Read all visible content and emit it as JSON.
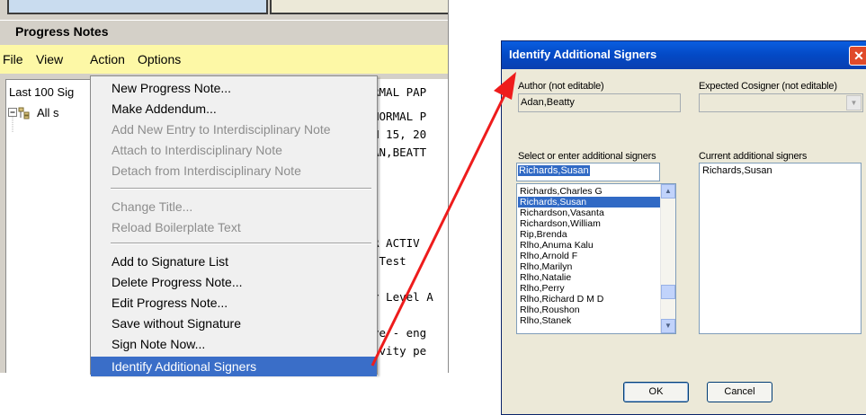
{
  "left_window": {
    "title": "Progress Notes",
    "menus": [
      "File",
      "View",
      "Action",
      "Options"
    ],
    "tree_header": "Last 100 Sig",
    "tree_node": "All s",
    "note_lines": [
      "RMAL PAP",
      "NORMAL P",
      "N 15, 20",
      "AN,BEATT",
      "R ACTIV",
      " Test",
      "r Level A",
      "ve - eng",
      "ivity pe"
    ]
  },
  "action_menu": {
    "items": [
      {
        "label": "New Progress Note...",
        "enabled": true
      },
      {
        "label": "Make Addendum...",
        "enabled": true
      },
      {
        "label": "Add New Entry to Interdisciplinary Note",
        "enabled": false
      },
      {
        "label": "Attach to Interdisciplinary Note",
        "enabled": false
      },
      {
        "label": "Detach from Interdisciplinary Note",
        "enabled": false
      },
      {
        "label": "Change Title...",
        "enabled": false
      },
      {
        "label": "Reload Boilerplate Text",
        "enabled": false
      },
      {
        "label": "Add to Signature List",
        "enabled": true
      },
      {
        "label": "Delete Progress Note...",
        "enabled": true
      },
      {
        "label": "Edit Progress Note...",
        "enabled": true
      },
      {
        "label": "Save without Signature",
        "enabled": true
      },
      {
        "label": "Sign Note Now...",
        "enabled": true
      },
      {
        "label": "Identify Additional Signers",
        "enabled": true,
        "selected": true
      }
    ]
  },
  "dialog": {
    "title": "Identify Additional Signers",
    "close_glyph": "✕",
    "author_label": "Author (not editable)",
    "author_value": "Adan,Beatty",
    "cosigner_label": "Expected Cosigner (not editable)",
    "cosigner_value": "",
    "select_label": "Select or enter additional signers",
    "search_value": "Richards,Susan",
    "signer_options": [
      "Richards,Charles G",
      "Richards,Susan",
      "Richardson,Vasanta",
      "Richardson,William",
      "Rip,Brenda",
      "Rlho,Anuma Kalu",
      "Rlho,Arnold F",
      "Rlho,Marilyn",
      "Rlho,Natalie",
      "Rlho,Perry",
      "Rlho,Richard D M D",
      "Rlho,Roushon",
      "Rlho,Stanek"
    ],
    "selected_option": "Richards,Susan",
    "current_label": "Current additional signers",
    "current_signers": [
      "Richards,Susan"
    ],
    "ok_label": "OK",
    "cancel_label": "Cancel"
  },
  "colors": {
    "menu_highlight": "#3a6ec8",
    "menubar_bg": "#fdf8a6",
    "dialog_title_bg": "#0a5ee0",
    "arrow": "#ee1c1c"
  }
}
